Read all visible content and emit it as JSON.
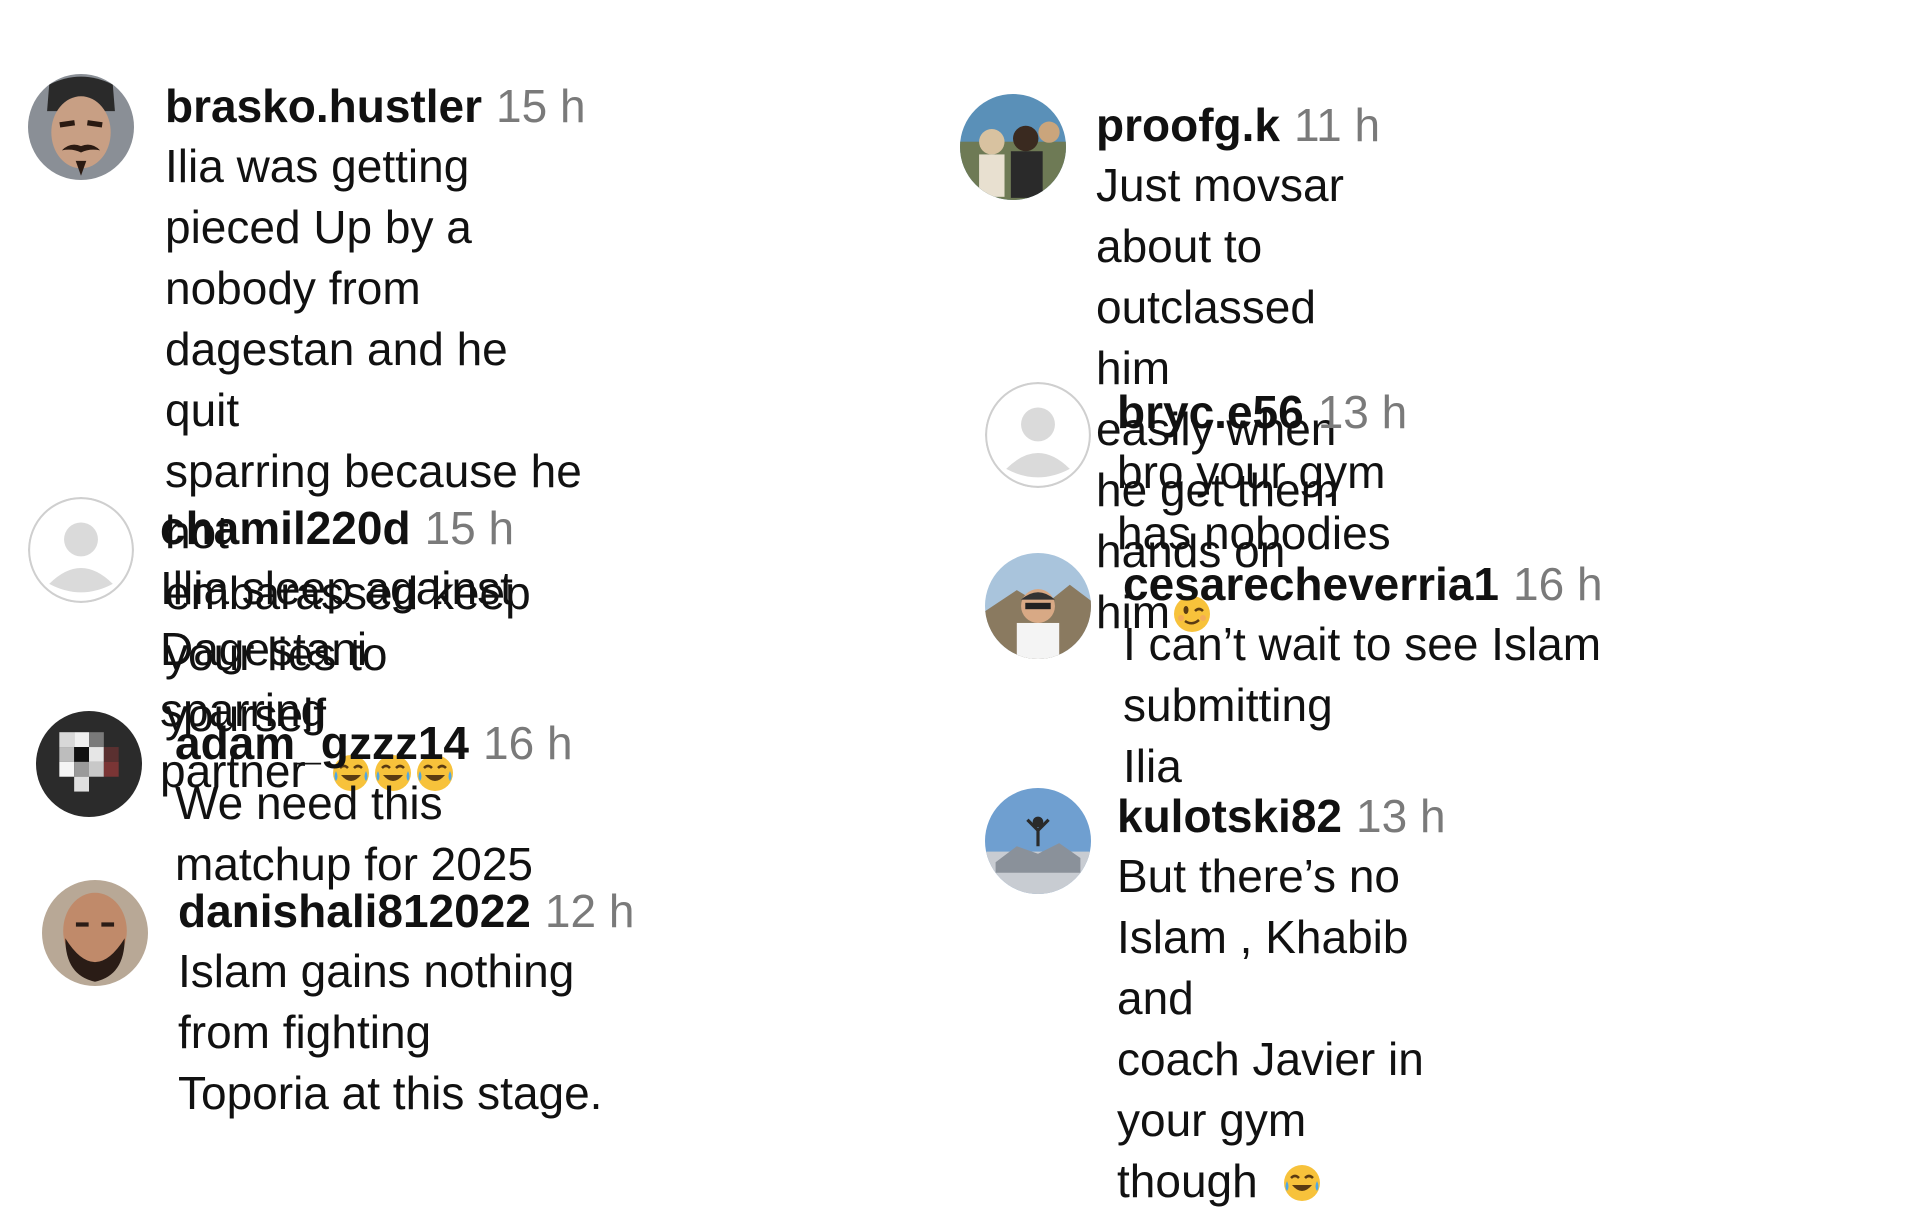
{
  "comments": [
    {
      "username": "brasko.hustler",
      "time": "15 h",
      "lines": [
        "Ilia was getting pieced Up by a",
        "nobody from dagestan and he quit",
        "sparring because he hot",
        "embarassed keep your lies to",
        "yourself"
      ]
    },
    {
      "username": "chamil220d",
      "time": "15 h",
      "lines": [
        "Illia sleep against Dagestani sparring",
        "partner"
      ],
      "emoji": [
        "tears-of-joy",
        "tears-of-joy",
        "tears-of-joy"
      ]
    },
    {
      "username": "adam_gzzz14",
      "time": "16 h",
      "lines": [
        "We need this matchup for 2025"
      ]
    },
    {
      "username": "danishali812022",
      "time": "12 h",
      "lines": [
        "Islam gains nothing from fighting",
        "Toporia at this stage."
      ]
    },
    {
      "username": "proofg.k",
      "time": "11 h",
      "lines": [
        "Just movsar about to outclassed him",
        "easily when he get them hands on",
        "him"
      ],
      "emoji": [
        "winking-face"
      ]
    },
    {
      "username": "bryc.e56",
      "time": "13 h",
      "lines": [
        "bro your gym has nobodies"
      ]
    },
    {
      "username": "cesarecheverria1",
      "time": "16 h",
      "lines": [
        "I can’t wait to see Islam submitting",
        "Ilia"
      ]
    },
    {
      "username": "kulotski82",
      "time": "13 h",
      "lines": [
        "But there’s no Islam , Khabib and",
        "coach Javier in your gym though"
      ],
      "emoji": [
        "tears-of-joy"
      ]
    }
  ],
  "colors": {
    "text": "#111111",
    "timestamp": "#7a7a7a",
    "default_avatar_bg": "#d9d9d9",
    "emoji_yellow": "#f7c23b"
  }
}
